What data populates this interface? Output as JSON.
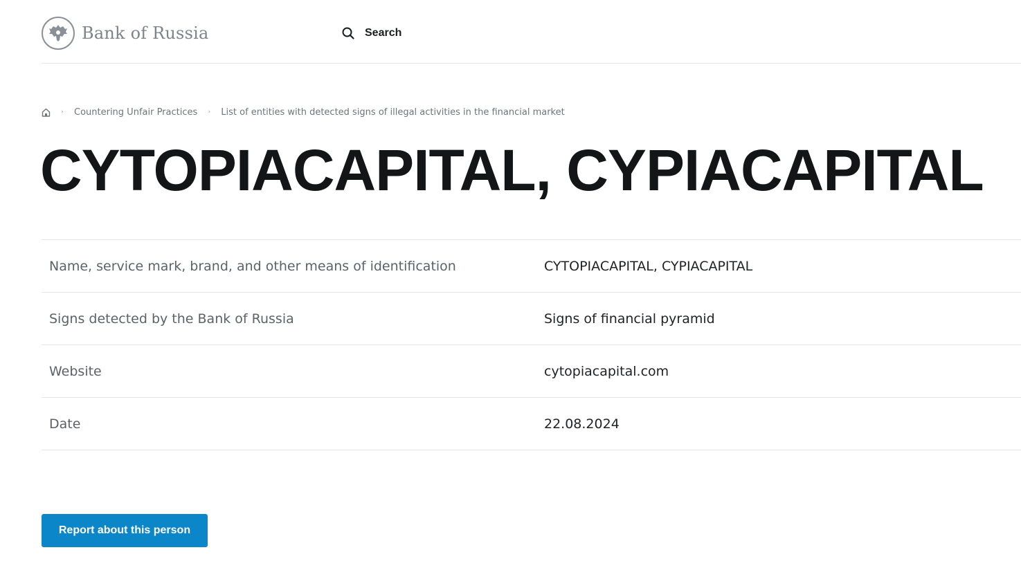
{
  "header": {
    "logo_text": "Bank of Russia",
    "search_label": "Search"
  },
  "breadcrumb": {
    "items": [
      {
        "label": "Countering Unfair Practices"
      },
      {
        "label": "List of entities with detected signs of illegal activities in the financial market"
      }
    ]
  },
  "page": {
    "title": "CYTOPIACAPITAL, CYPIACAPITAL"
  },
  "details": {
    "rows": [
      {
        "label": "Name, service mark, brand, and other means of identification",
        "value": "CYTOPIACAPITAL, CYPIACAPITAL"
      },
      {
        "label": "Signs detected by the Bank of Russia",
        "value": "Signs of financial pyramid"
      },
      {
        "label": "Website",
        "value": "cytopiacapital.com"
      },
      {
        "label": "Date",
        "value": "22.08.2024"
      }
    ]
  },
  "actions": {
    "report_label": "Report about this person"
  },
  "colors": {
    "accent": "#0a86c9",
    "divider": "#e3e5e8",
    "muted_text": "#6e747b"
  },
  "icons": {
    "logo": "double-headed-eagle-icon",
    "search": "search-icon",
    "home": "home-icon",
    "separator": "chevron-right-icon"
  }
}
